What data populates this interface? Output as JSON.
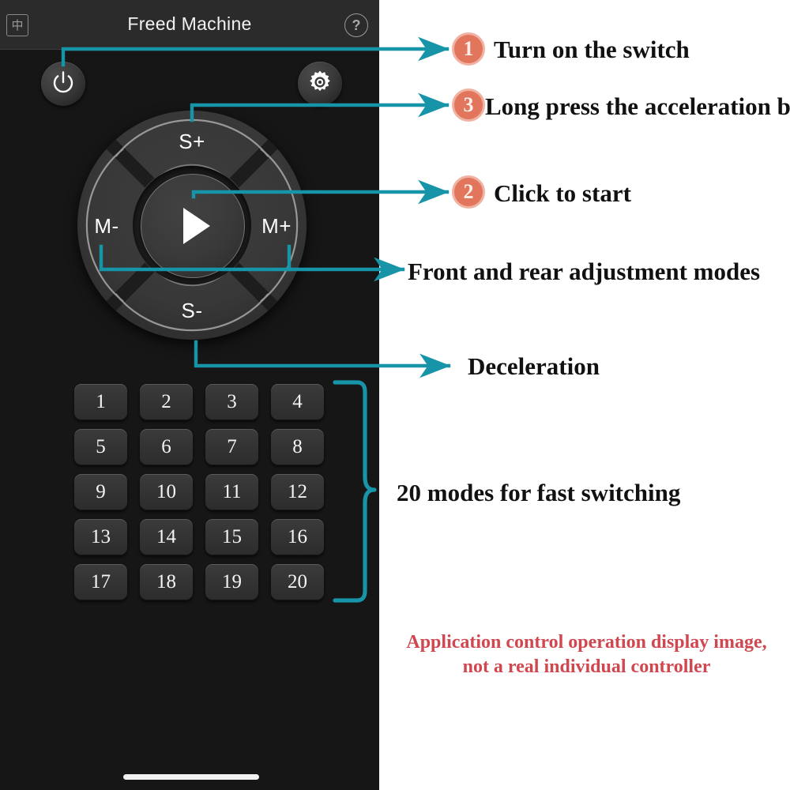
{
  "app": {
    "header": {
      "title": "Freed Machine",
      "lang_toggle": "中",
      "help_icon": "?"
    },
    "controls": {
      "power_icon": "power-icon",
      "settings_icon": "gear-icon",
      "dpad": {
        "up_label": "S+",
        "down_label": "S-",
        "left_label": "M-",
        "right_label": "M+",
        "center_icon": "play-icon"
      }
    },
    "mode_keys": [
      "1",
      "2",
      "3",
      "4",
      "5",
      "6",
      "7",
      "8",
      "9",
      "10",
      "11",
      "12",
      "13",
      "14",
      "15",
      "16",
      "17",
      "18",
      "19",
      "20"
    ]
  },
  "annotations": {
    "steps": [
      {
        "badge": "1",
        "text": "Turn on the switch"
      },
      {
        "badge": "3",
        "text": "Long press the acceleration button"
      },
      {
        "badge": "2",
        "text": "Click to start"
      }
    ],
    "labels": [
      {
        "text": "Front and rear adjustment modes"
      },
      {
        "text": "Deceleration"
      },
      {
        "text": "20 modes for fast switching"
      }
    ],
    "disclaimer_line1": "Application control operation display image,",
    "disclaimer_line2": "not a real individual controller"
  },
  "colors": {
    "arrow": "#1794a8",
    "badge_fill": "#e2765c",
    "badge_ring": "#f0b3a3",
    "disclaimer": "#d1474f",
    "panel_bg": "#161616",
    "header_bg": "#2b2b2b"
  }
}
